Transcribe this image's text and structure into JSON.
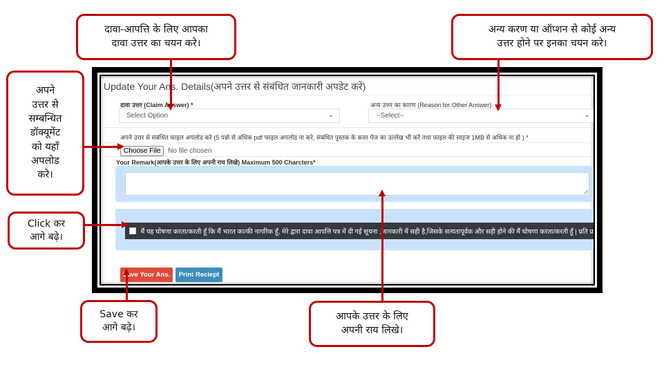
{
  "form": {
    "title": "Update Your Ans. Details(अपने उत्तर से संबंधित जानकारी अपडेट करें)",
    "claim_answer": {
      "label": "दावा उत्तर (Claim Answer) *",
      "selected": "Select Option",
      "chevron": "⌄"
    },
    "other_reason": {
      "label": "अन्य उत्तर का कारण (Reason for Other Answer)",
      "selected": "--Select--",
      "chevron": "⌄"
    },
    "upload": {
      "label": "अपने उत्तर से संबंधित फाइल अपलोड करे (5 पन्नो से अधिक pdf फाइल अपलोड ना करे, संबंधित पुस्तक के कवर पेज का उल्लेख भी करें तथा फाइल की साइज 1MB से अधिक ना हो ) *",
      "button": "Choose File",
      "status": "No file chosen"
    },
    "remark": {
      "label": "Your Remark(आपके उत्तर के लिए अपनी राय लिखे) Maximum 500 Charcters*",
      "value": ""
    },
    "declaration": {
      "checked": false,
      "text": "मैं यह घोषणा करता/करती हूँ कि मैं भारत का/की नागरिक हूँ, मेरे द्वारा दावा आपत्ति पत्र में दी गई सूचना ,जानकारी में सही है,जिसके सत्यतापूर्वक और सही होने की मैं घोषणा करता/करती हूँ | प्रति प्र"
    },
    "buttons": {
      "save": "Save Your Ans.",
      "print": "Print Reciept"
    }
  },
  "callouts": {
    "claim": [
      "दावा-आपत्ति के लिए आपका",
      "दावा उत्तर का चयन करे।"
    ],
    "other": [
      "अन्य करण या ऑप्शन से कोई अन्य",
      "उत्तर होने पर इनका चयन करे।"
    ],
    "upload": [
      "अपने",
      "उत्तर से",
      "सम्बन्धित",
      "डॉक्यूमेंट",
      "को यहाँ",
      "अपलोड",
      "करे।"
    ],
    "click": [
      "Click कर",
      "आगे बढ़े।"
    ],
    "save": [
      "Save कर",
      "आगे बढ़े।"
    ],
    "remark": [
      "आपके उत्तर के लिए",
      "अपनी राय लिखे।"
    ]
  },
  "colors": {
    "callout_border": "#c00000",
    "save_button": "#dd4b39",
    "print_button": "#3c8dbc",
    "declaration_bar": "#343a40",
    "highlight_box": "#c9e2fb"
  }
}
